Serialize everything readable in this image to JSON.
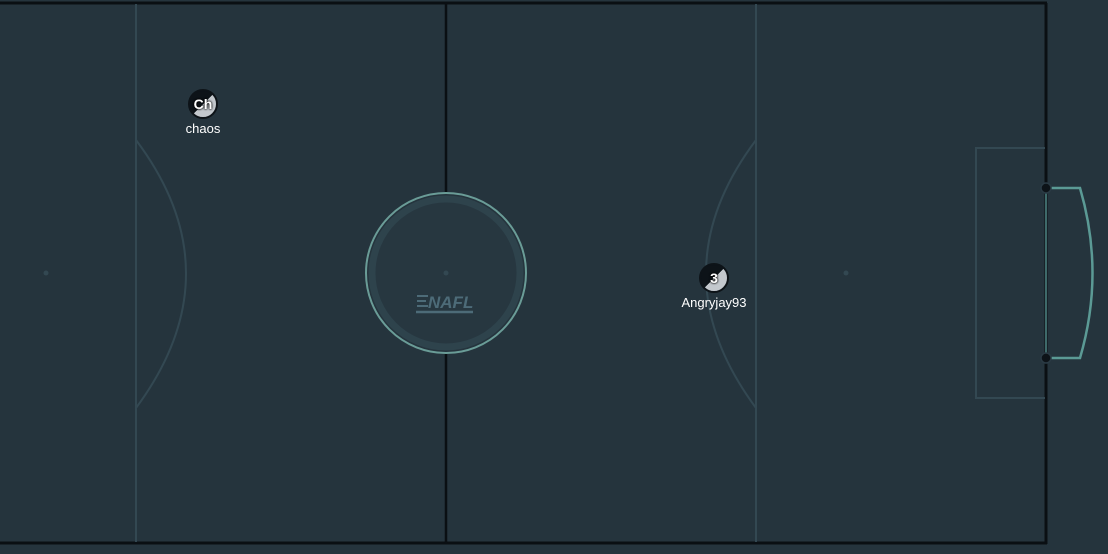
{
  "pitch": {
    "surface_color": "#25343d",
    "line_color": "#334852",
    "boundary_color": "#0a0f13",
    "goal_color": "#5b9a95",
    "center_circle_color": "#6a9c97",
    "logo_color": "#4d6b78"
  },
  "logo": {
    "icon": "nafl-logo-icon",
    "text": "NAFL"
  },
  "players": [
    {
      "token_label": "Ch",
      "name": "chaos",
      "icon": "player-token-icon"
    },
    {
      "token_label": "3",
      "name": "Angryjay93",
      "icon": "player-token-icon"
    }
  ]
}
